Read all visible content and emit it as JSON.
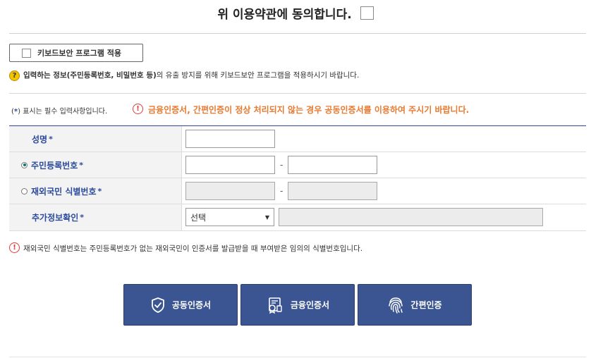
{
  "agree": {
    "label": "위 이용약관에 동의합니다."
  },
  "keyboard": {
    "button_label": "키보드보안 프로그램 적용",
    "info_bold": "입력하는 정보(주민등록번호, 비밀번호 등)",
    "info_rest": "의 유출 방지를 위해 키보드보안 프로그램을 적용하시기 바랍니다."
  },
  "notice": {
    "required_prefix": "(",
    "required_star": "*",
    "required_suffix": ") 표시는 필수 입력사항입니다.",
    "warning": "금융인증서, 간편인증이 정상 처리되지 않는 경우 공동인증서를 이용하여 주시기 바랍니다."
  },
  "form": {
    "star": "*",
    "name_label": "성명",
    "resident_label": "주민등록번호",
    "foreign_label": "재외국민 식별번호",
    "extra_label": "추가정보확인",
    "dash": "-",
    "select_value": "선택"
  },
  "bottom_note": "재외국민 식별번호는 주민등록번호가 없는 재외국민이 인증서를 발급받을 때 부여받은 임의의 식별번호입니다.",
  "buttons": {
    "joint": "공동인증서",
    "financial": "금융인증서",
    "simple": "간편인증"
  },
  "icons": {
    "question": "?",
    "warning": "!"
  },
  "colors": {
    "accent": "#2b4a9c",
    "button": "#3a5591",
    "warning_text": "#e8792f",
    "warning_icon": "#e03a3a"
  }
}
